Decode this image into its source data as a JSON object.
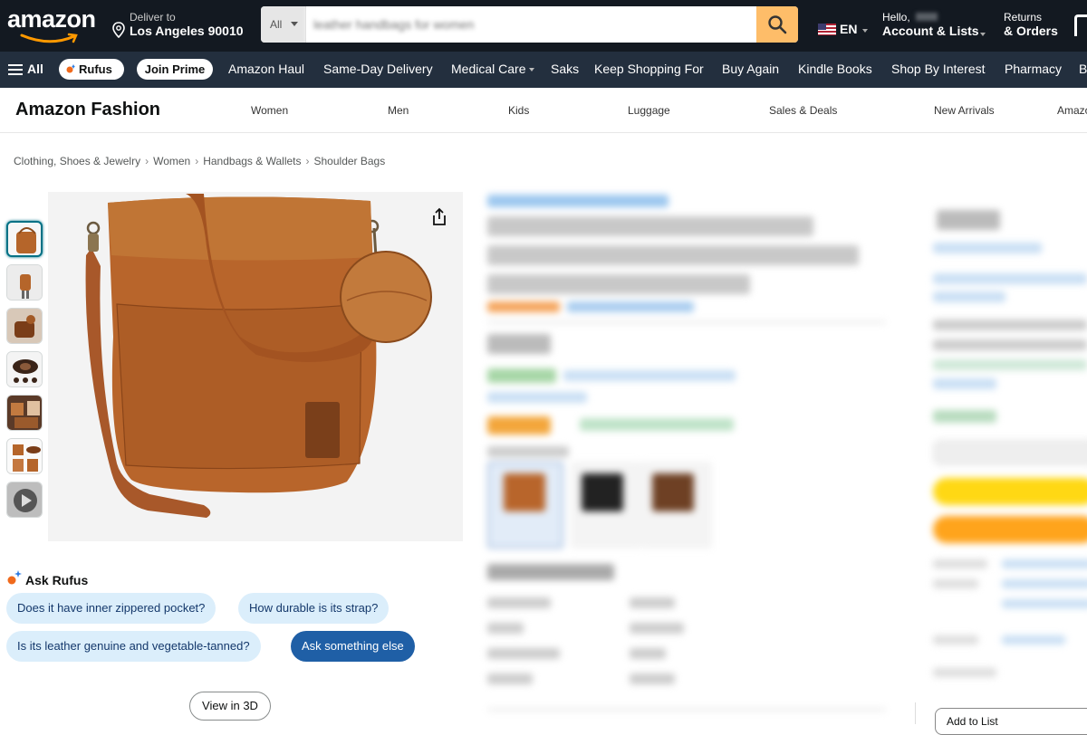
{
  "header": {
    "logo_text": "amazon",
    "deliver_line1": "Deliver to",
    "deliver_line2": "Los Angeles 90010",
    "search_category": "All",
    "search_placeholder": "leather handbags for women",
    "lang": "EN",
    "account_line1": "Hello,",
    "account_line2": "Account & Lists",
    "orders_line1": "Returns",
    "orders_line2": "& Orders"
  },
  "nav": {
    "all_label": "All",
    "rufus_label": "Rufus",
    "prime_label": "Join Prime",
    "links": [
      "Amazon Haul",
      "Same-Day Delivery",
      "Medical Care",
      "Saks",
      "Keep Shopping For",
      "Buy Again",
      "Kindle Books",
      "Shop By Interest",
      "Pharmacy",
      "B"
    ]
  },
  "fashion": {
    "title": "Amazon Fashion",
    "categories": [
      "Women",
      "Men",
      "Kids",
      "Luggage",
      "Sales & Deals",
      "New Arrivals",
      "Amazo"
    ]
  },
  "breadcrumb": [
    "Clothing, Shoes & Jewelry",
    "Women",
    "Handbags & Wallets",
    "Shoulder Bags"
  ],
  "rufus": {
    "title": "Ask Rufus",
    "questions": [
      "Does it have inner zippered pocket?",
      "How durable is its strap?",
      "Is its leather genuine and vegetable-tanned?",
      "Ask something else"
    ]
  },
  "view_3d_label": "View in 3D",
  "buybox": {
    "add_to_list_label": "Add to List"
  },
  "colors": {
    "header_bg": "#131921",
    "nav_bg": "#232f3e",
    "search_button": "#febd69",
    "chip_bg": "#dbeefb",
    "chip_dark_bg": "#1f5fa6",
    "add_to_cart": "#ffd814",
    "buy_now": "#ffa41c",
    "bag_leather": "#b5652a"
  },
  "icons": [
    "location-pin-icon",
    "search-icon",
    "flag-us-icon",
    "hamburger-icon",
    "rufus-icon",
    "share-icon",
    "sparkle-icon",
    "play-icon"
  ]
}
